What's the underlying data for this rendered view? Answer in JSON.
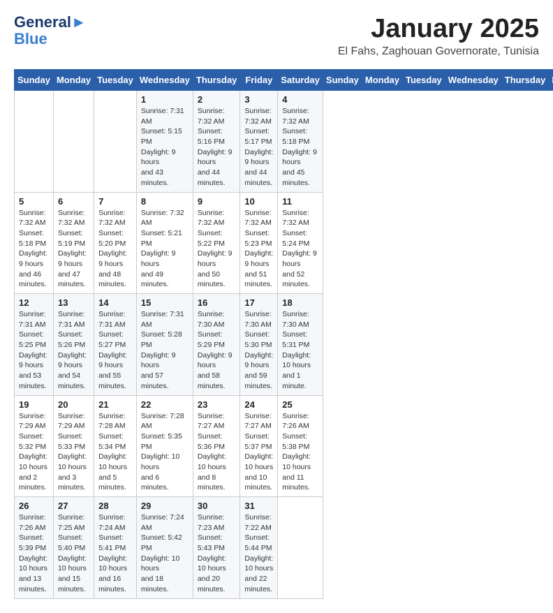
{
  "header": {
    "logo_line1": "General",
    "logo_line2": "Blue",
    "month_title": "January 2025",
    "location": "El Fahs, Zaghouan Governorate, Tunisia"
  },
  "calendar": {
    "days_of_week": [
      "Sunday",
      "Monday",
      "Tuesday",
      "Wednesday",
      "Thursday",
      "Friday",
      "Saturday"
    ],
    "weeks": [
      [
        {
          "day": "",
          "content": ""
        },
        {
          "day": "",
          "content": ""
        },
        {
          "day": "",
          "content": ""
        },
        {
          "day": "1",
          "content": "Sunrise: 7:31 AM\nSunset: 5:15 PM\nDaylight: 9 hours\nand 43 minutes."
        },
        {
          "day": "2",
          "content": "Sunrise: 7:32 AM\nSunset: 5:16 PM\nDaylight: 9 hours\nand 44 minutes."
        },
        {
          "day": "3",
          "content": "Sunrise: 7:32 AM\nSunset: 5:17 PM\nDaylight: 9 hours\nand 44 minutes."
        },
        {
          "day": "4",
          "content": "Sunrise: 7:32 AM\nSunset: 5:18 PM\nDaylight: 9 hours\nand 45 minutes."
        }
      ],
      [
        {
          "day": "5",
          "content": "Sunrise: 7:32 AM\nSunset: 5:18 PM\nDaylight: 9 hours\nand 46 minutes."
        },
        {
          "day": "6",
          "content": "Sunrise: 7:32 AM\nSunset: 5:19 PM\nDaylight: 9 hours\nand 47 minutes."
        },
        {
          "day": "7",
          "content": "Sunrise: 7:32 AM\nSunset: 5:20 PM\nDaylight: 9 hours\nand 48 minutes."
        },
        {
          "day": "8",
          "content": "Sunrise: 7:32 AM\nSunset: 5:21 PM\nDaylight: 9 hours\nand 49 minutes."
        },
        {
          "day": "9",
          "content": "Sunrise: 7:32 AM\nSunset: 5:22 PM\nDaylight: 9 hours\nand 50 minutes."
        },
        {
          "day": "10",
          "content": "Sunrise: 7:32 AM\nSunset: 5:23 PM\nDaylight: 9 hours\nand 51 minutes."
        },
        {
          "day": "11",
          "content": "Sunrise: 7:32 AM\nSunset: 5:24 PM\nDaylight: 9 hours\nand 52 minutes."
        }
      ],
      [
        {
          "day": "12",
          "content": "Sunrise: 7:31 AM\nSunset: 5:25 PM\nDaylight: 9 hours\nand 53 minutes."
        },
        {
          "day": "13",
          "content": "Sunrise: 7:31 AM\nSunset: 5:26 PM\nDaylight: 9 hours\nand 54 minutes."
        },
        {
          "day": "14",
          "content": "Sunrise: 7:31 AM\nSunset: 5:27 PM\nDaylight: 9 hours\nand 55 minutes."
        },
        {
          "day": "15",
          "content": "Sunrise: 7:31 AM\nSunset: 5:28 PM\nDaylight: 9 hours\nand 57 minutes."
        },
        {
          "day": "16",
          "content": "Sunrise: 7:30 AM\nSunset: 5:29 PM\nDaylight: 9 hours\nand 58 minutes."
        },
        {
          "day": "17",
          "content": "Sunrise: 7:30 AM\nSunset: 5:30 PM\nDaylight: 9 hours\nand 59 minutes."
        },
        {
          "day": "18",
          "content": "Sunrise: 7:30 AM\nSunset: 5:31 PM\nDaylight: 10 hours\nand 1 minute."
        }
      ],
      [
        {
          "day": "19",
          "content": "Sunrise: 7:29 AM\nSunset: 5:32 PM\nDaylight: 10 hours\nand 2 minutes."
        },
        {
          "day": "20",
          "content": "Sunrise: 7:29 AM\nSunset: 5:33 PM\nDaylight: 10 hours\nand 3 minutes."
        },
        {
          "day": "21",
          "content": "Sunrise: 7:28 AM\nSunset: 5:34 PM\nDaylight: 10 hours\nand 5 minutes."
        },
        {
          "day": "22",
          "content": "Sunrise: 7:28 AM\nSunset: 5:35 PM\nDaylight: 10 hours\nand 6 minutes."
        },
        {
          "day": "23",
          "content": "Sunrise: 7:27 AM\nSunset: 5:36 PM\nDaylight: 10 hours\nand 8 minutes."
        },
        {
          "day": "24",
          "content": "Sunrise: 7:27 AM\nSunset: 5:37 PM\nDaylight: 10 hours\nand 10 minutes."
        },
        {
          "day": "25",
          "content": "Sunrise: 7:26 AM\nSunset: 5:38 PM\nDaylight: 10 hours\nand 11 minutes."
        }
      ],
      [
        {
          "day": "26",
          "content": "Sunrise: 7:26 AM\nSunset: 5:39 PM\nDaylight: 10 hours\nand 13 minutes."
        },
        {
          "day": "27",
          "content": "Sunrise: 7:25 AM\nSunset: 5:40 PM\nDaylight: 10 hours\nand 15 minutes."
        },
        {
          "day": "28",
          "content": "Sunrise: 7:24 AM\nSunset: 5:41 PM\nDaylight: 10 hours\nand 16 minutes."
        },
        {
          "day": "29",
          "content": "Sunrise: 7:24 AM\nSunset: 5:42 PM\nDaylight: 10 hours\nand 18 minutes."
        },
        {
          "day": "30",
          "content": "Sunrise: 7:23 AM\nSunset: 5:43 PM\nDaylight: 10 hours\nand 20 minutes."
        },
        {
          "day": "31",
          "content": "Sunrise: 7:22 AM\nSunset: 5:44 PM\nDaylight: 10 hours\nand 22 minutes."
        },
        {
          "day": "",
          "content": ""
        }
      ]
    ]
  }
}
